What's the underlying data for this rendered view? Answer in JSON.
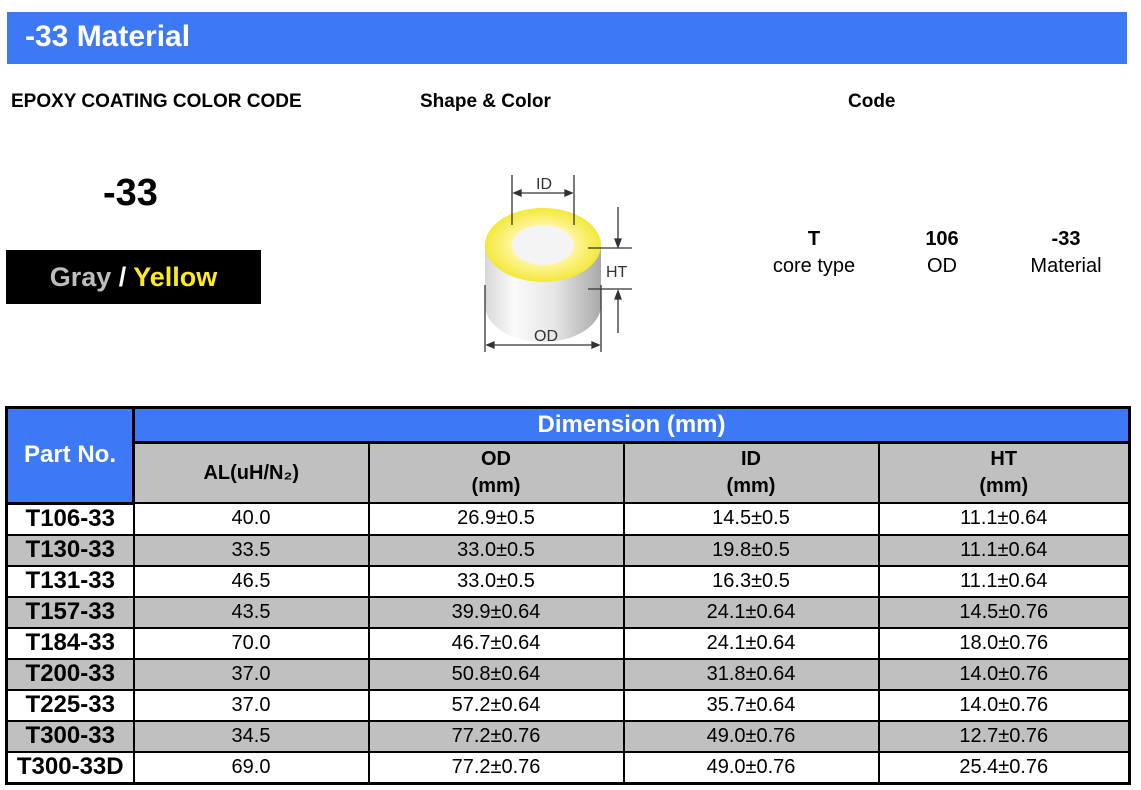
{
  "title": "-33 Material",
  "headers": {
    "epoxy": "EPOXY COATING COLOR CODE",
    "shape": "Shape & Color",
    "code": "Code"
  },
  "material_code": "-33",
  "color": {
    "gray": "Gray",
    "sep": " / ",
    "yellow": "Yellow",
    "gray_hex": "#bdbdbd",
    "yellow_hex": "#ffea1f"
  },
  "diagram": {
    "id_label": "ID",
    "ht_label": "HT",
    "od_label": "OD"
  },
  "code_parts": [
    {
      "key": "T",
      "desc": "core type"
    },
    {
      "key": "106",
      "desc": "OD"
    },
    {
      "key": "-33",
      "desc": "Material"
    }
  ],
  "table": {
    "part_header": "Part No.",
    "dimension_header": "Dimension (mm)",
    "columns": [
      {
        "l1": "AL(uH/N₂)",
        "l2": ""
      },
      {
        "l1": "OD",
        "l2": "(mm)"
      },
      {
        "l1": "ID",
        "l2": "(mm)"
      },
      {
        "l1": "HT",
        "l2": "(mm)"
      }
    ],
    "rows": [
      [
        "T106-33",
        "40.0",
        "26.9±0.5",
        "14.5±0.5",
        "11.1±0.64"
      ],
      [
        "T130-33",
        "33.5",
        "33.0±0.5",
        "19.8±0.5",
        "11.1±0.64"
      ],
      [
        "T131-33",
        "46.5",
        "33.0±0.5",
        "16.3±0.5",
        "11.1±0.64"
      ],
      [
        "T157-33",
        "43.5",
        "39.9±0.64",
        "24.1±0.64",
        "14.5±0.76"
      ],
      [
        "T184-33",
        "70.0",
        "46.7±0.64",
        "24.1±0.64",
        "18.0±0.76"
      ],
      [
        "T200-33",
        "37.0",
        "50.8±0.64",
        "31.8±0.64",
        "14.0±0.76"
      ],
      [
        "T225-33",
        "37.0",
        "57.2±0.64",
        "35.7±0.64",
        "14.0±0.76"
      ],
      [
        "T300-33",
        "34.5",
        "77.2±0.76",
        "49.0±0.76",
        "12.7±0.76"
      ],
      [
        "T300-33D",
        "69.0",
        "77.2±0.76",
        "49.0±0.76",
        "25.4±0.76"
      ]
    ]
  }
}
